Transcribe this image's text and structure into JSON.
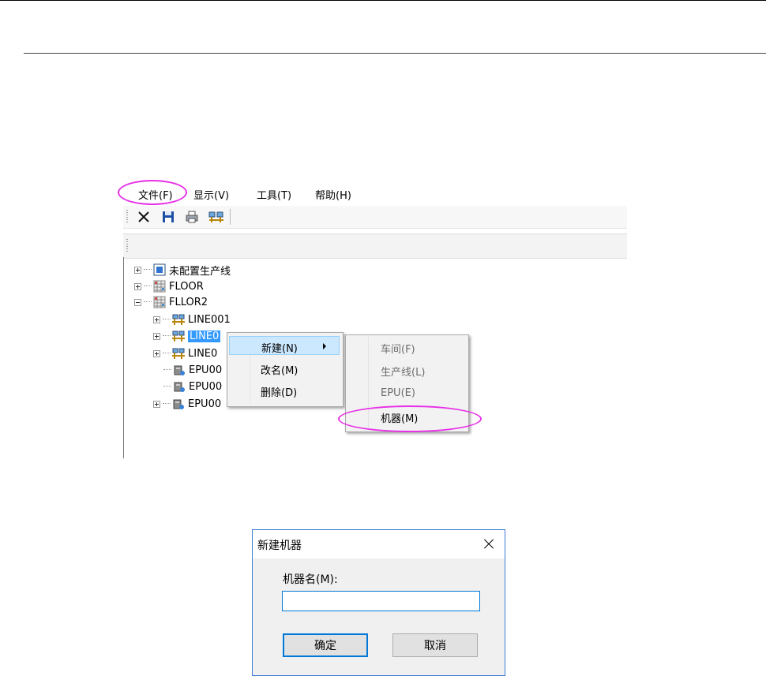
{
  "menubar": {
    "file": "文件(F)",
    "view": "显示(V)",
    "tools": "工具(T)",
    "help": "帮助(H)"
  },
  "toolbar": {
    "icons": [
      "delete-icon",
      "save-icon",
      "print-icon",
      "line-icon"
    ]
  },
  "tree": {
    "nodes": [
      {
        "label": "未配置生产线",
        "icon": "unconfigured-icon"
      },
      {
        "label": "FLOOR",
        "icon": "floor-icon"
      },
      {
        "label": "FLLOR2",
        "icon": "floor-icon"
      },
      {
        "label": "LINE001",
        "icon": "line-icon"
      },
      {
        "label": "LINE0",
        "icon": "line-icon",
        "selected": true
      },
      {
        "label": "LINE0",
        "icon": "line-icon"
      },
      {
        "label": "EPU00",
        "icon": "epu-icon"
      },
      {
        "label": "EPU00",
        "icon": "epu-icon"
      },
      {
        "label": "EPU00",
        "icon": "epu-icon"
      }
    ]
  },
  "context_menu": {
    "items": [
      "新建(N)",
      "改名(M)",
      "删除(D)"
    ]
  },
  "submenu": {
    "items": [
      "车间(F)",
      "生产线(L)",
      "EPU(E)",
      "机器(M)"
    ]
  },
  "dialog": {
    "title": "新建机器",
    "label": "机器名(M):",
    "input_value": "",
    "ok": "确定",
    "cancel": "取消"
  },
  "colors": {
    "highlight_ring": "#e830e8",
    "selection": "#3399ff",
    "menu_hover": "#cce8ff",
    "dialog_accent": "#0078d7"
  }
}
